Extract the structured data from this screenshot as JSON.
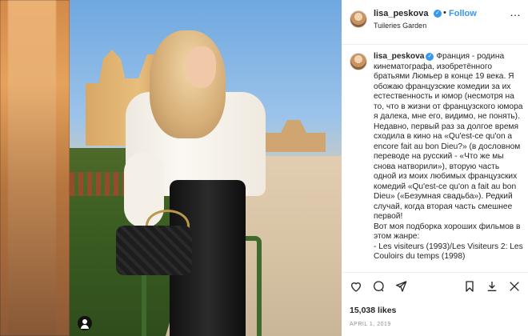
{
  "post": {
    "username": "lisa_peskova",
    "follow_label": "Follow",
    "separator": "•",
    "location": "Tuileries Garden",
    "more_icon": "…",
    "caption": "Франция - родина кинематографа, изобретённого братьями Люмьер в конце 19 века. Я обожаю французские комедии за их естественность и юмор (несмотря на то, что в жизни от французского юмора я далека, мне его, видимо, не понять). Недавно, первый раз за долгое время сходила в кино на «Qu'est-ce qu'on a encore fait au bon Dieu?» (в дословном переводе на русский - «Что же мы снова натворили»), вторую часть одной из моих любимых французских комедий «Qu'est-ce qu'on a fait au bon Dieu» («Безумная свадьба»). Редкий случай, когда вторая часть смешнее первой!\nВот моя подборка хороших фильмов в этом жанре:\n- Les visiteurs (1993)/Les Visiteurs 2: Les Couloirs du temps (1998)",
    "likes": "15,038 likes",
    "date": "APRIL 1, 2019"
  },
  "icons": {
    "verified": "verified-badge-icon",
    "like": "heart-icon",
    "comment": "comment-icon",
    "share": "share-icon",
    "save": "bookmark-icon",
    "tag": "user-tag-icon"
  },
  "colors": {
    "accent": "#3897f0",
    "text": "#262626",
    "muted": "#8e8e8e"
  }
}
